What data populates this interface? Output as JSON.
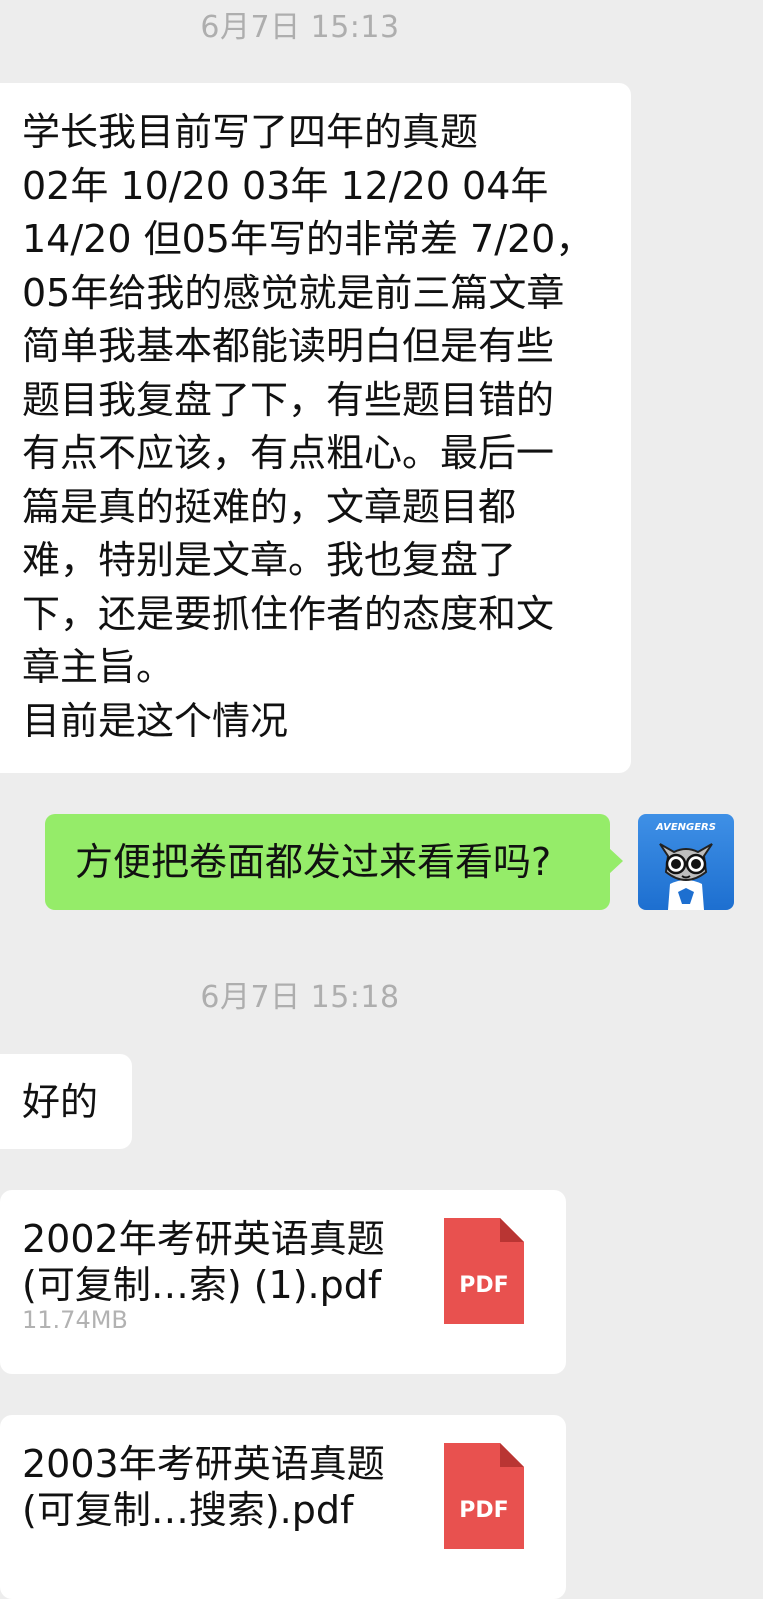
{
  "timestamps": [
    "6月7日 15:13",
    "6月7日 15:18"
  ],
  "messages": {
    "m1": "学长我目前写了四年的真题\n02年 10/20 03年 12/20 04年\n14/20 但05年写的非常差 7/20，\n05年给我的感觉就是前三篇文章\n简单我基本都能读明白但是有些\n题目我复盘了下，有些题目错的\n有点不应该，有点粗心。最后一\n篇是真的挺难的，文章题目都\n难，特别是文章。我也复盘了\n下，还是要抓住作者的态度和文\n章主旨。\n目前是这个情况",
    "m2": "方便把卷面都发过来看看吗?",
    "m3": "好的"
  },
  "files": [
    {
      "title": "2002年考研英语真题\n(可复制…索) (1).pdf",
      "size": "11.74MB",
      "badge": "PDF"
    },
    {
      "title": "2003年考研英语真题\n(可复制…搜索).pdf",
      "size": "",
      "badge": "PDF"
    }
  ],
  "avatar": {
    "label": "AVENGERS"
  },
  "colors": {
    "background": "#ededed",
    "received_bubble": "#ffffff",
    "sent_bubble": "#95ec69",
    "timestamp": "#aeaeae",
    "pdf_red": "#e8514f"
  }
}
